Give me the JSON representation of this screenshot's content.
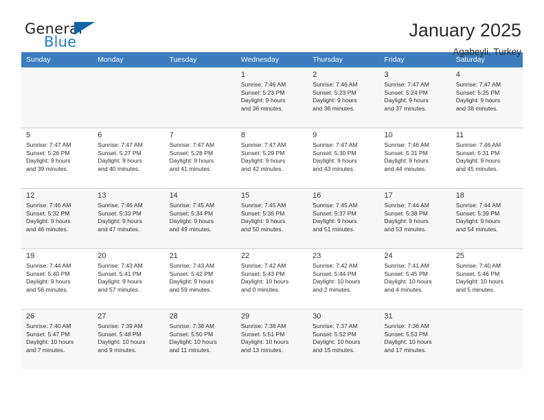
{
  "brand": {
    "name_part1": "General",
    "name_part2": "Blue",
    "logo_icon": "triangle-logo-icon"
  },
  "header": {
    "title": "January 2025",
    "subtitle": "Agabeyli, Turkey"
  },
  "calendar": {
    "weekday_headers": [
      "Sunday",
      "Monday",
      "Tuesday",
      "Wednesday",
      "Thursday",
      "Friday",
      "Saturday"
    ],
    "accent_color": "#3b7cbf",
    "weeks": [
      [
        {
          "day": "",
          "sunrise": "",
          "sunset": "",
          "daylight_line1": "",
          "daylight_line2": "",
          "empty": true
        },
        {
          "day": "",
          "sunrise": "",
          "sunset": "",
          "daylight_line1": "",
          "daylight_line2": "",
          "empty": true
        },
        {
          "day": "",
          "sunrise": "",
          "sunset": "",
          "daylight_line1": "",
          "daylight_line2": "",
          "empty": true
        },
        {
          "day": "1",
          "sunrise": "Sunrise: 7:46 AM",
          "sunset": "Sunset: 5:23 PM",
          "daylight_line1": "Daylight: 9 hours",
          "daylight_line2": "and 36 minutes."
        },
        {
          "day": "2",
          "sunrise": "Sunrise: 7:46 AM",
          "sunset": "Sunset: 5:23 PM",
          "daylight_line1": "Daylight: 9 hours",
          "daylight_line2": "and 36 minutes."
        },
        {
          "day": "3",
          "sunrise": "Sunrise: 7:47 AM",
          "sunset": "Sunset: 5:24 PM",
          "daylight_line1": "Daylight: 9 hours",
          "daylight_line2": "and 37 minutes."
        },
        {
          "day": "4",
          "sunrise": "Sunrise: 7:47 AM",
          "sunset": "Sunset: 5:25 PM",
          "daylight_line1": "Daylight: 9 hours",
          "daylight_line2": "and 38 minutes."
        }
      ],
      [
        {
          "day": "5",
          "sunrise": "Sunrise: 7:47 AM",
          "sunset": "Sunset: 5:26 PM",
          "daylight_line1": "Daylight: 9 hours",
          "daylight_line2": "and 39 minutes."
        },
        {
          "day": "6",
          "sunrise": "Sunrise: 7:47 AM",
          "sunset": "Sunset: 5:27 PM",
          "daylight_line1": "Daylight: 9 hours",
          "daylight_line2": "and 40 minutes."
        },
        {
          "day": "7",
          "sunrise": "Sunrise: 7:47 AM",
          "sunset": "Sunset: 5:28 PM",
          "daylight_line1": "Daylight: 9 hours",
          "daylight_line2": "and 41 minutes."
        },
        {
          "day": "8",
          "sunrise": "Sunrise: 7:47 AM",
          "sunset": "Sunset: 5:29 PM",
          "daylight_line1": "Daylight: 9 hours",
          "daylight_line2": "and 42 minutes."
        },
        {
          "day": "9",
          "sunrise": "Sunrise: 7:47 AM",
          "sunset": "Sunset: 5:30 PM",
          "daylight_line1": "Daylight: 9 hours",
          "daylight_line2": "and 43 minutes."
        },
        {
          "day": "10",
          "sunrise": "Sunrise: 7:46 AM",
          "sunset": "Sunset: 5:31 PM",
          "daylight_line1": "Daylight: 9 hours",
          "daylight_line2": "and 44 minutes."
        },
        {
          "day": "11",
          "sunrise": "Sunrise: 7:46 AM",
          "sunset": "Sunset: 5:31 PM",
          "daylight_line1": "Daylight: 9 hours",
          "daylight_line2": "and 45 minutes."
        }
      ],
      [
        {
          "day": "12",
          "sunrise": "Sunrise: 7:46 AM",
          "sunset": "Sunset: 5:32 PM",
          "daylight_line1": "Daylight: 9 hours",
          "daylight_line2": "and 46 minutes."
        },
        {
          "day": "13",
          "sunrise": "Sunrise: 7:46 AM",
          "sunset": "Sunset: 5:33 PM",
          "daylight_line1": "Daylight: 9 hours",
          "daylight_line2": "and 47 minutes."
        },
        {
          "day": "14",
          "sunrise": "Sunrise: 7:45 AM",
          "sunset": "Sunset: 5:34 PM",
          "daylight_line1": "Daylight: 9 hours",
          "daylight_line2": "and 49 minutes."
        },
        {
          "day": "15",
          "sunrise": "Sunrise: 7:45 AM",
          "sunset": "Sunset: 5:36 PM",
          "daylight_line1": "Daylight: 9 hours",
          "daylight_line2": "and 50 minutes."
        },
        {
          "day": "16",
          "sunrise": "Sunrise: 7:45 AM",
          "sunset": "Sunset: 5:37 PM",
          "daylight_line1": "Daylight: 9 hours",
          "daylight_line2": "and 51 minutes."
        },
        {
          "day": "17",
          "sunrise": "Sunrise: 7:44 AM",
          "sunset": "Sunset: 5:38 PM",
          "daylight_line1": "Daylight: 9 hours",
          "daylight_line2": "and 53 minutes."
        },
        {
          "day": "18",
          "sunrise": "Sunrise: 7:44 AM",
          "sunset": "Sunset: 5:39 PM",
          "daylight_line1": "Daylight: 9 hours",
          "daylight_line2": "and 54 minutes."
        }
      ],
      [
        {
          "day": "19",
          "sunrise": "Sunrise: 7:44 AM",
          "sunset": "Sunset: 5:40 PM",
          "daylight_line1": "Daylight: 9 hours",
          "daylight_line2": "and 56 minutes."
        },
        {
          "day": "20",
          "sunrise": "Sunrise: 7:43 AM",
          "sunset": "Sunset: 5:41 PM",
          "daylight_line1": "Daylight: 9 hours",
          "daylight_line2": "and 57 minutes."
        },
        {
          "day": "21",
          "sunrise": "Sunrise: 7:43 AM",
          "sunset": "Sunset: 5:42 PM",
          "daylight_line1": "Daylight: 9 hours",
          "daylight_line2": "and 59 minutes."
        },
        {
          "day": "22",
          "sunrise": "Sunrise: 7:42 AM",
          "sunset": "Sunset: 5:43 PM",
          "daylight_line1": "Daylight: 10 hours",
          "daylight_line2": "and 0 minutes."
        },
        {
          "day": "23",
          "sunrise": "Sunrise: 7:42 AM",
          "sunset": "Sunset: 5:44 PM",
          "daylight_line1": "Daylight: 10 hours",
          "daylight_line2": "and 2 minutes."
        },
        {
          "day": "24",
          "sunrise": "Sunrise: 7:41 AM",
          "sunset": "Sunset: 5:45 PM",
          "daylight_line1": "Daylight: 10 hours",
          "daylight_line2": "and 4 minutes."
        },
        {
          "day": "25",
          "sunrise": "Sunrise: 7:40 AM",
          "sunset": "Sunset: 5:46 PM",
          "daylight_line1": "Daylight: 10 hours",
          "daylight_line2": "and 5 minutes."
        }
      ],
      [
        {
          "day": "26",
          "sunrise": "Sunrise: 7:40 AM",
          "sunset": "Sunset: 5:47 PM",
          "daylight_line1": "Daylight: 10 hours",
          "daylight_line2": "and 7 minutes."
        },
        {
          "day": "27",
          "sunrise": "Sunrise: 7:39 AM",
          "sunset": "Sunset: 5:48 PM",
          "daylight_line1": "Daylight: 10 hours",
          "daylight_line2": "and 9 minutes."
        },
        {
          "day": "28",
          "sunrise": "Sunrise: 7:38 AM",
          "sunset": "Sunset: 5:50 PM",
          "daylight_line1": "Daylight: 10 hours",
          "daylight_line2": "and 11 minutes."
        },
        {
          "day": "29",
          "sunrise": "Sunrise: 7:38 AM",
          "sunset": "Sunset: 5:51 PM",
          "daylight_line1": "Daylight: 10 hours",
          "daylight_line2": "and 13 minutes."
        },
        {
          "day": "30",
          "sunrise": "Sunrise: 7:37 AM",
          "sunset": "Sunset: 5:52 PM",
          "daylight_line1": "Daylight: 10 hours",
          "daylight_line2": "and 15 minutes."
        },
        {
          "day": "31",
          "sunrise": "Sunrise: 7:36 AM",
          "sunset": "Sunset: 5:53 PM",
          "daylight_line1": "Daylight: 10 hours",
          "daylight_line2": "and 17 minutes."
        },
        {
          "day": "",
          "sunrise": "",
          "sunset": "",
          "daylight_line1": "",
          "daylight_line2": "",
          "empty": true
        }
      ]
    ]
  }
}
